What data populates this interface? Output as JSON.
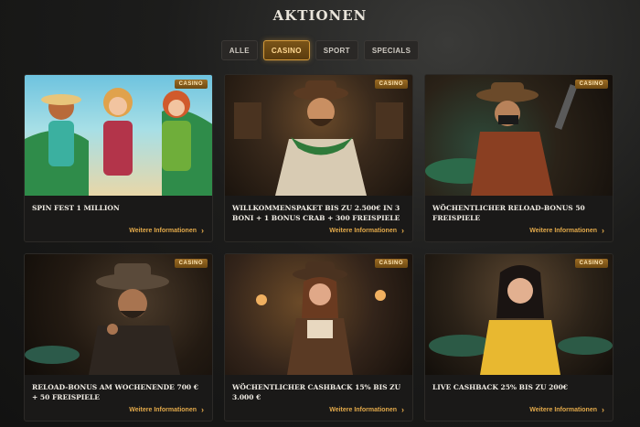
{
  "header": {
    "title": "AKTIONEN"
  },
  "filters": [
    {
      "label": "ALLE",
      "active": false
    },
    {
      "label": "CASINO",
      "active": true
    },
    {
      "label": "SPORT",
      "active": false
    },
    {
      "label": "SPECIALS",
      "active": false
    }
  ],
  "cards": [
    {
      "badge": "CASINO",
      "title": "SPIN FEST 1 MILLION",
      "link": "Weitere Informationen"
    },
    {
      "badge": "CASINO",
      "title": "WILLKOMMENSPAKET BIS ZU 2.500€ IN 3 BONI + 1 BONUS CRAB + 300 FREISPIELE",
      "link": "Weitere Informationen"
    },
    {
      "badge": "CASINO",
      "title": "WÖCHENTLICHER RELOAD-BONUS 50 FREISPIELE",
      "link": "Weitere Informationen"
    },
    {
      "badge": "CASINO",
      "title": "RELOAD-BONUS AM WOCHENENDE 700 € + 50 FREISPIELE",
      "link": "Weitere Informationen"
    },
    {
      "badge": "CASINO",
      "title": "WÖCHENTLICHER CASHBACK 15% BIS ZU 3.000 €",
      "link": "Weitere Informationen"
    },
    {
      "badge": "CASINO",
      "title": "LIVE CASHBACK 25% BIS ZU 200€",
      "link": "Weitere Informationen"
    }
  ],
  "colors": {
    "accent": "#e2a94a",
    "badge": "#9c6c24",
    "card_bg": "#1a1918"
  },
  "icons": {
    "link_arrow": "chevron-right-icon"
  }
}
